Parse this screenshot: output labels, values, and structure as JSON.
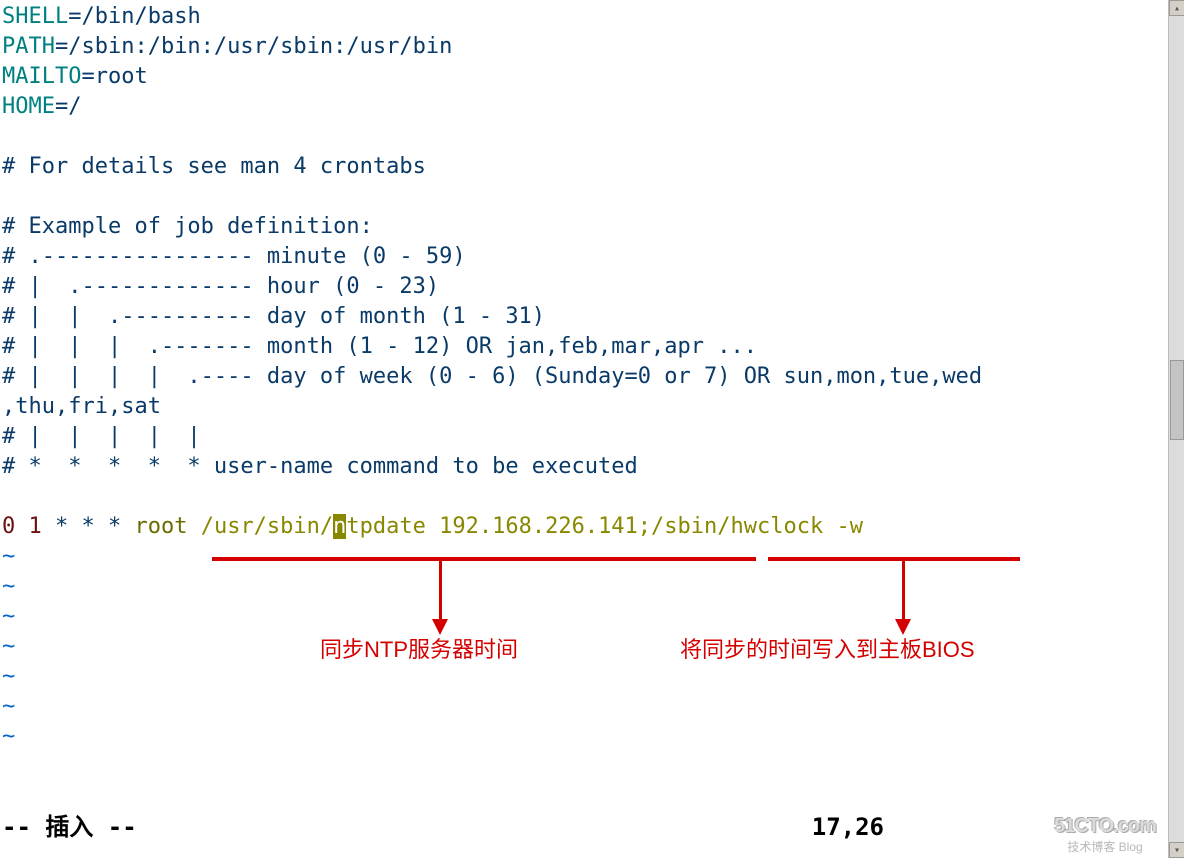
{
  "env": {
    "shell_var": "SHELL",
    "shell_val": "=/bin/bash",
    "path_var": "PATH",
    "path_val": "=/sbin:/bin:/usr/sbin:/usr/bin",
    "mailto_var": "MAILTO",
    "mailto_val": "=root",
    "home_var": "HOME",
    "home_val": "=/"
  },
  "comments": {
    "c1": "# For details see man 4 crontabs",
    "c2": "# Example of job definition:",
    "c3": "# .---------------- minute (0 - 59)",
    "c4": "# |  .------------- hour (0 - 23)",
    "c5": "# |  |  .---------- day of month (1 - 31)",
    "c6": "# |  |  |  .------- month (1 - 12) OR jan,feb,mar,apr ...",
    "c7": "# |  |  |  |  .---- day of week (0 - 6) (Sunday=0 or 7) OR sun,mon,tue,wed",
    "c7b": ",thu,fri,sat",
    "c8": "# |  |  |  |  |",
    "c9": "# *  *  *  *  * user-name command to be executed"
  },
  "cron": {
    "min": "0",
    "gap1": " ",
    "hour": "1",
    "stars": " * * * ",
    "user": "root ",
    "cmd_a": "/usr/sbin/",
    "cmd_cursor": "n",
    "cmd_b": "tpdate 192.168.226.141;",
    "cmd_c": "/sbin/hwclock -w"
  },
  "tildes": {
    "t": "~"
  },
  "status": {
    "mode": "-- 插入 --",
    "pos": "17,26"
  },
  "annotations": {
    "left": "同步NTP服务器时间",
    "right": "将同步的时间写入到主板BIOS"
  },
  "watermark": {
    "top": "51CTO.com",
    "sub": "技术博客  Blog"
  }
}
